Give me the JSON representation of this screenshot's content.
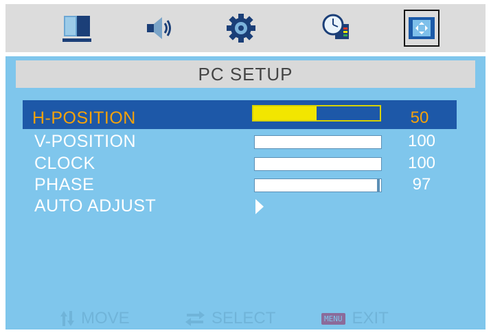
{
  "tabs": [
    {
      "name": "picture",
      "icon": "monitor-icon",
      "active": false
    },
    {
      "name": "audio",
      "icon": "speaker-icon",
      "active": false
    },
    {
      "name": "settings",
      "icon": "gear-icon",
      "active": false
    },
    {
      "name": "timer",
      "icon": "clock-icon",
      "active": false
    },
    {
      "name": "pc-setup",
      "icon": "screen-adjust-icon",
      "active": true
    }
  ],
  "title": "PC SETUP",
  "items": [
    {
      "label": "H-POSITION",
      "value": "50",
      "level": 50,
      "selected": true
    },
    {
      "label": "V-POSITION",
      "value": "100",
      "level": 100,
      "selected": false
    },
    {
      "label": "CLOCK",
      "value": "100",
      "level": 100,
      "selected": false
    },
    {
      "label": "PHASE",
      "value": "97",
      "level": 97,
      "selected": false
    },
    {
      "label": "AUTO ADJUST",
      "value": "",
      "selected": false
    }
  ],
  "footer": {
    "move_label": "MOVE",
    "select_label": "SELECT",
    "menu_key": "MENU",
    "exit_label": "EXIT"
  },
  "colors": {
    "background": "#7fc6ec",
    "highlight_row": "#1d58a8",
    "selected_text": "#f5a20a",
    "slider_fill": "#f2e600",
    "footer_text": "#70b4d9"
  }
}
